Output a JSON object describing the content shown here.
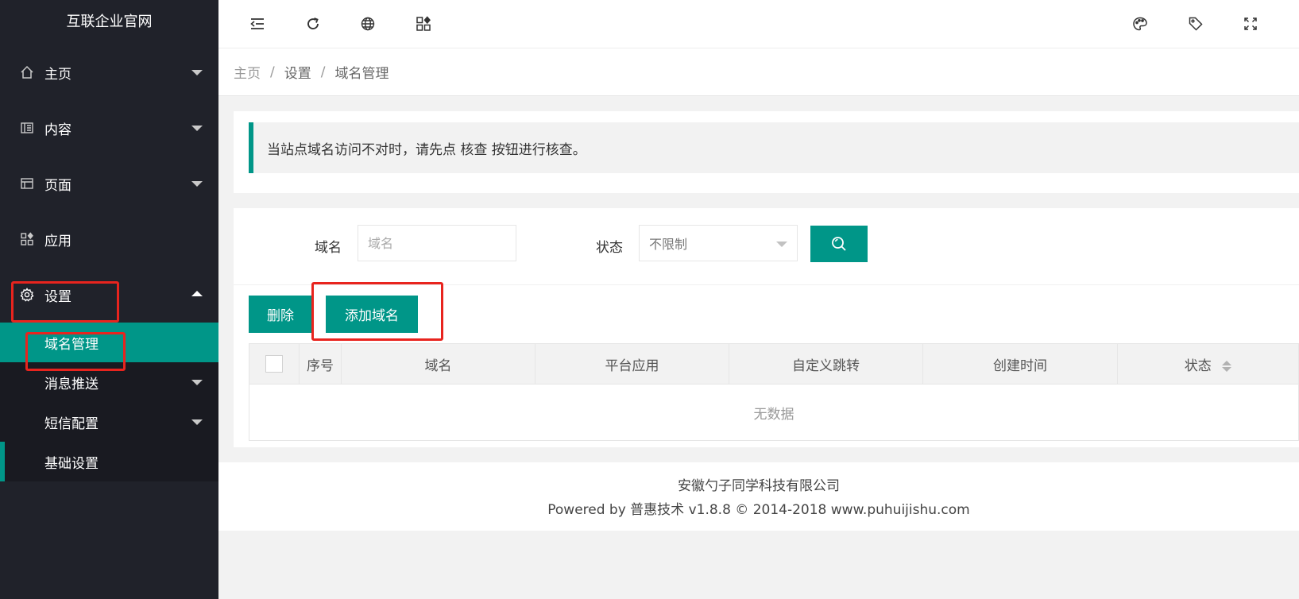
{
  "sidebar": {
    "logo": "互联企业官网",
    "items": [
      {
        "label": "主页",
        "icon": "home-icon"
      },
      {
        "label": "内容",
        "icon": "content-icon"
      },
      {
        "label": "页面",
        "icon": "page-icon"
      },
      {
        "label": "应用",
        "icon": "apps-icon"
      },
      {
        "label": "设置",
        "icon": "gear-icon"
      }
    ],
    "settings_sub": [
      {
        "label": "域名管理"
      },
      {
        "label": "消息推送"
      },
      {
        "label": "短信配置"
      },
      {
        "label": "基础设置"
      }
    ]
  },
  "header": {
    "icons": [
      "menu-collapse-icon",
      "refresh-icon",
      "globe-icon",
      "apps-icon",
      "palette-icon",
      "tag-icon",
      "fullscreen-icon"
    ]
  },
  "breadcrumb": [
    "主页",
    "设置",
    "域名管理"
  ],
  "notice": "当站点域名访问不对时，请先点 核查 按钮进行核查。",
  "filter": {
    "domain_label": "域名",
    "domain_placeholder": "域名",
    "status_label": "状态",
    "status_value": "不限制"
  },
  "actions": {
    "delete": "删除",
    "add_domain": "添加域名"
  },
  "table": {
    "columns": [
      "序号",
      "域名",
      "平台应用",
      "自定义跳转",
      "创建时间",
      "状态"
    ],
    "empty": "无数据"
  },
  "footer": {
    "company": "安徽勺子同学科技有限公司",
    "powered": "Powered by 普惠技术 v1.8.8 © 2014-2018 www.puhuijishu.com"
  },
  "colors": {
    "accent": "#009688",
    "sidebar_bg": "#20222a",
    "highlight": "#e8241e"
  }
}
